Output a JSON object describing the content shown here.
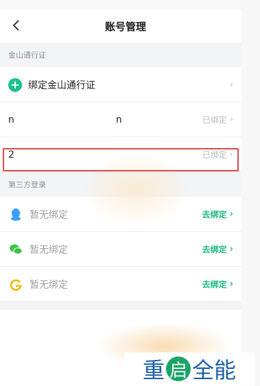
{
  "header": {
    "title": "账号管理"
  },
  "kingsoft_section": {
    "label": "金山通行证",
    "bind_row": {
      "label": "绑定金山通行证"
    },
    "accounts": [
      {
        "prefix": "n",
        "suffix": "n",
        "status": "已绑定"
      },
      {
        "prefix": "2",
        "suffix": "",
        "status": "已绑定"
      }
    ]
  },
  "third_party_section": {
    "label": "第三方登录",
    "items": [
      {
        "icon": "qq-icon",
        "label": "暂无绑定",
        "action": "去绑定"
      },
      {
        "icon": "wechat-icon",
        "label": "暂无绑定",
        "action": "去绑定"
      },
      {
        "icon": "google-icon",
        "label": "暂无绑定",
        "action": "去绑定"
      }
    ]
  },
  "watermark": {
    "part1": "重",
    "part2": "启",
    "part3": "全能"
  },
  "colors": {
    "accent": "#1fb984",
    "highlight": "#e1464a",
    "qq": "#3aa0ff",
    "wechat": "#3ec24a",
    "google": "#f5b800"
  }
}
